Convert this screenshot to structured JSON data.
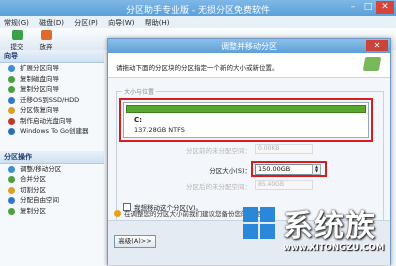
{
  "app": {
    "title": "分区助手专业版 - 无损分区免费软件",
    "menu": [
      "常规(G)",
      "磁盘(D)",
      "分区(P)",
      "向导(W)",
      "帮助(H)"
    ],
    "toolbar": [
      "提交",
      "放弃"
    ]
  },
  "sidebar": {
    "wizard_title": "向导",
    "wizard_items": [
      "扩展分区向导",
      "复制磁盘向导",
      "复制分区向导",
      "迁移OS到SSD/HDD",
      "分区恢复向导",
      "制作启动光盘向导",
      "Windows To Go创建器"
    ],
    "ops_title": "分区操作",
    "ops_items": [
      "调整/移动分区",
      "合并分区",
      "切割分区",
      "分配自由空间",
      "复制分区"
    ]
  },
  "dialog": {
    "title": "调整并移动分区",
    "instruction": "请拖动下面的分区块的分区指定一个新的大小或新位置。",
    "group_label": "大小与位置",
    "partition_name": "C:",
    "partition_info": "137.28GB NTFS",
    "fields": [
      {
        "label": "分区前的未分配空间：",
        "value": "0.00KB",
        "active": false
      },
      {
        "label": "分区大小(S)：",
        "value": "150.00GB",
        "active": true
      },
      {
        "label": "分区后的未分配空间：",
        "value": "85.40GB",
        "active": false
      }
    ],
    "checkbox_label": "我想移动这个分区(V)。",
    "warning": "在调整您的分区大小前我们建议您备份您的重要数据",
    "advanced_button": "高级(A)>>"
  },
  "watermark": {
    "text": "系统族",
    "url": "www.XITONGZU.COM"
  }
}
